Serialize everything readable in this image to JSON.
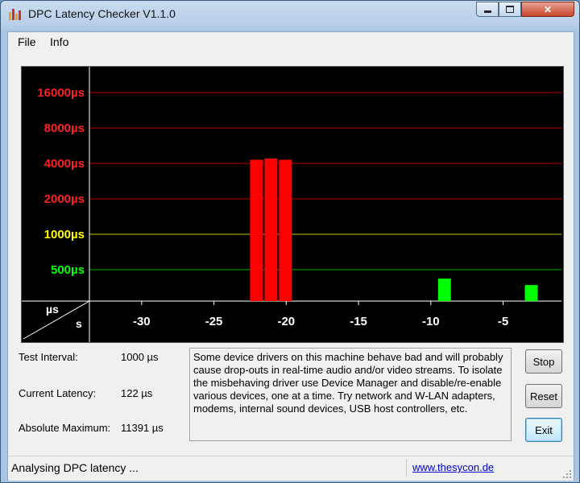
{
  "window": {
    "title": "DPC Latency Checker V1.1.0"
  },
  "menu": {
    "file": "File",
    "info": "Info"
  },
  "chart_data": {
    "type": "bar",
    "y_scale": "log",
    "y_ticks": [
      {
        "label": "16000µs",
        "value": 16000,
        "color": "#ff2020"
      },
      {
        "label": "8000µs",
        "value": 8000,
        "color": "#ff2020"
      },
      {
        "label": "4000µs",
        "value": 4000,
        "color": "#ff2020"
      },
      {
        "label": "2000µs",
        "value": 2000,
        "color": "#ff2020"
      },
      {
        "label": "1000µs",
        "value": 1000,
        "color": "#ffff00"
      },
      {
        "label": "500µs",
        "value": 500,
        "color": "#00ff00"
      }
    ],
    "x_ticks": [
      "-30",
      "-25",
      "-20",
      "-15",
      "-10",
      "-5"
    ],
    "x_tick_values": [
      -30,
      -25,
      -20,
      -15,
      -10,
      -5
    ],
    "y_unit_label": "µs",
    "x_unit_label": "s",
    "x": [
      -33,
      -32,
      -31,
      -30,
      -29,
      -28,
      -27,
      -26,
      -25,
      -24,
      -23,
      -22,
      -21,
      -20,
      -19,
      -18,
      -17,
      -16,
      -15,
      -14,
      -13,
      -12,
      -11,
      -10,
      -9,
      -8,
      -7,
      -6,
      -5,
      -4,
      -3,
      -2,
      -1
    ],
    "values": [
      150,
      170,
      150,
      170,
      170,
      170,
      160,
      270,
      150,
      200,
      160,
      4300,
      4400,
      4300,
      170,
      170,
      160,
      150,
      170,
      160,
      180,
      180,
      150,
      170,
      420,
      170,
      150,
      170,
      150,
      150,
      370,
      160,
      170
    ],
    "bar_colors": {
      "low": "#00ff00",
      "high": "#ff0000"
    },
    "threshold_high": 2000
  },
  "stats": {
    "test_interval_label": "Test Interval:",
    "test_interval_value": "1000 µs",
    "current_latency_label": "Current Latency:",
    "current_latency_value": "122 µs",
    "absolute_max_label": "Absolute Maximum:",
    "absolute_max_value": "11391 µs"
  },
  "message": "Some device drivers on this machine behave bad and will probably cause drop-outs in real-time audio and/or video streams. To isolate the misbehaving driver use Device Manager and disable/re-enable various devices, one at a time. Try network and W-LAN adapters, modems, internal sound devices, USB host controllers, etc.",
  "buttons": {
    "stop": "Stop",
    "reset": "Reset",
    "exit": "Exit"
  },
  "status": {
    "text": "Analysing DPC latency ...",
    "link": "www.thesycon.de"
  }
}
